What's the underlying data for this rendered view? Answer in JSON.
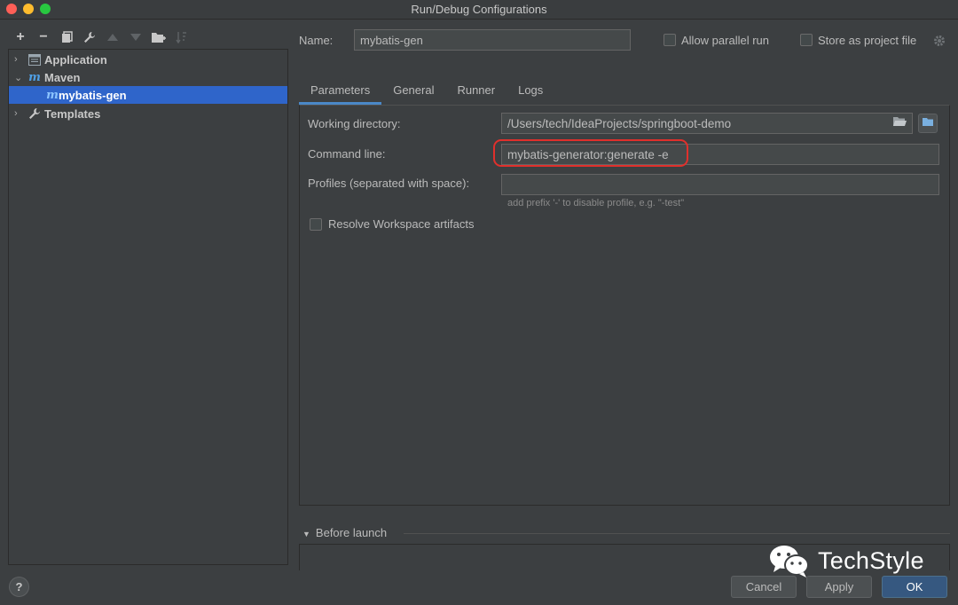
{
  "window": {
    "title": "Run/Debug Configurations"
  },
  "toolbar": {
    "icons": [
      "add-icon",
      "remove-icon",
      "copy-icon",
      "wrench-icon",
      "move-up-icon",
      "move-down-icon",
      "new-folder-icon",
      "sort-icon"
    ],
    "glyphs": {
      "add": "+",
      "remove": "−",
      "copy": "⧉",
      "wrench": "🔧",
      "up": "▲",
      "down": "▼",
      "folder": "▆",
      "sort": "⇅"
    }
  },
  "tree": {
    "items": [
      {
        "label": "Application",
        "arrow": "›",
        "icon": "application-icon"
      },
      {
        "label": "Maven",
        "arrow": "⌄",
        "icon": "maven-icon",
        "icon_text": "m"
      },
      {
        "label": "mybatis-gen",
        "icon": "maven-icon",
        "icon_text": "m",
        "selected": true
      },
      {
        "label": "Templates",
        "arrow": "›",
        "icon": "wrench-icon"
      }
    ]
  },
  "header": {
    "name_label": "Name:",
    "name_value": "mybatis-gen",
    "allow_parallel_label": "Allow parallel run",
    "store_project_label": "Store as project file"
  },
  "tabs": [
    {
      "label": "Parameters",
      "active": true
    },
    {
      "label": "General"
    },
    {
      "label": "Runner"
    },
    {
      "label": "Logs"
    }
  ],
  "parameters": {
    "working_dir_label": "Working directory:",
    "working_dir_value": "/Users/tech/IdeaProjects/springboot-demo",
    "command_line_label": "Command line:",
    "command_line_value": "mybatis-generator:generate -e",
    "profiles_label": "Profiles (separated with space):",
    "profiles_value": "",
    "profiles_hint": "add prefix '-' to disable profile, e.g. \"-test\"",
    "resolve_label": "Resolve Workspace artifacts"
  },
  "before_launch": {
    "label": "Before launch"
  },
  "footer": {
    "help": "?",
    "cancel": "Cancel",
    "apply": "Apply",
    "ok": "OK"
  },
  "watermark": {
    "text": "TechStyle"
  },
  "colors": {
    "background": "#3c3f41",
    "selection": "#2f65ca",
    "primary_button": "#365880",
    "highlight_ring": "#e0302c",
    "maven": "#4f9fe4"
  }
}
